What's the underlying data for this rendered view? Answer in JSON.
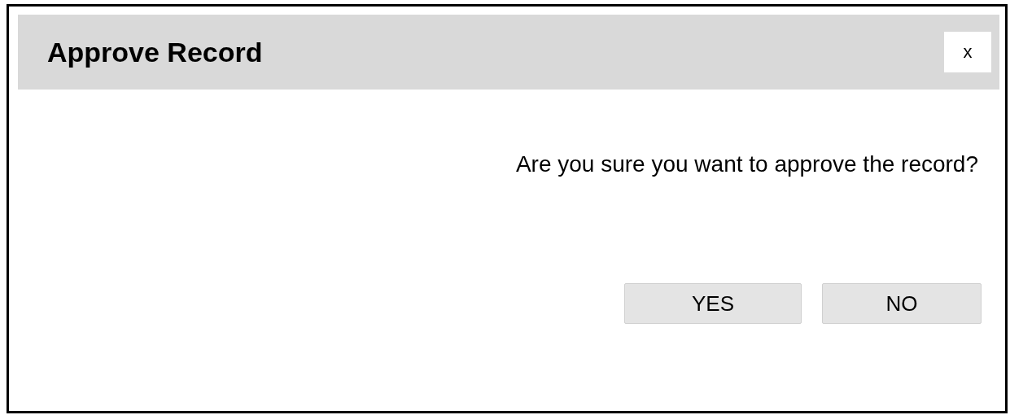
{
  "dialog": {
    "title": "Approve Record",
    "close_label": "x",
    "message": "Are you sure you want to approve the record?",
    "buttons": [
      "YES",
      "NO"
    ]
  }
}
